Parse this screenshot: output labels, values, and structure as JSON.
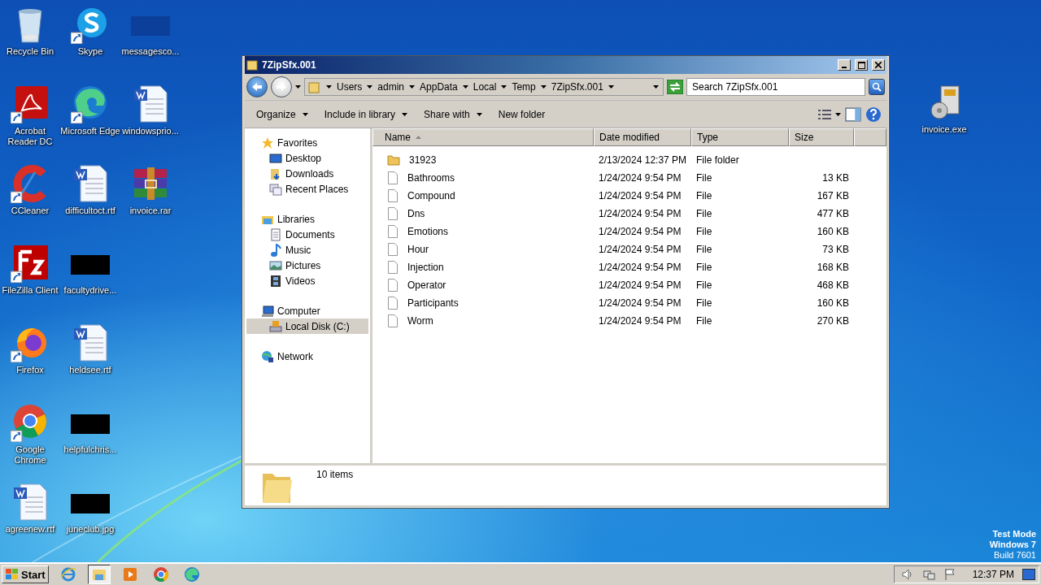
{
  "desktop": {
    "icons": [
      {
        "label": "Recycle Bin",
        "kind": "recycle",
        "shortcut": false
      },
      {
        "label": "Acrobat Reader DC",
        "kind": "acrobat",
        "shortcut": true
      },
      {
        "label": "CCleaner",
        "kind": "ccleaner",
        "shortcut": true
      },
      {
        "label": "FileZilla Client",
        "kind": "filezilla",
        "shortcut": true
      },
      {
        "label": "Firefox",
        "kind": "firefox",
        "shortcut": true
      },
      {
        "label": "Google Chrome",
        "kind": "chrome",
        "shortcut": true
      },
      {
        "label": "agreenew.rtf",
        "kind": "word",
        "shortcut": false
      },
      {
        "label": "Skype",
        "kind": "skype",
        "shortcut": true
      },
      {
        "label": "Microsoft Edge",
        "kind": "edge",
        "shortcut": true
      },
      {
        "label": "difficultoct.rtf",
        "kind": "word",
        "shortcut": false
      },
      {
        "label": "facultydrive...",
        "kind": "redacted",
        "shortcut": false
      },
      {
        "label": "heldsee.rtf",
        "kind": "word",
        "shortcut": false
      },
      {
        "label": "helpfulchris...",
        "kind": "redacted",
        "shortcut": false
      },
      {
        "label": "juneclub.jpg",
        "kind": "redacted",
        "shortcut": false
      },
      {
        "label": "messagesco...",
        "kind": "hidden",
        "shortcut": false
      },
      {
        "label": "windowsprio...",
        "kind": "word",
        "shortcut": false
      },
      {
        "label": "invoice.rar",
        "kind": "rar",
        "shortcut": false
      }
    ],
    "right_icons": [
      {
        "label": "invoice.exe",
        "kind": "exe",
        "shortcut": false
      }
    ],
    "test_mode": [
      "Test Mode",
      "Windows 7",
      "Build 7601"
    ]
  },
  "window": {
    "title": "7ZipSfx.001",
    "address": [
      "Users",
      "admin",
      "AppData",
      "Local",
      "Temp",
      "7ZipSfx.001"
    ],
    "search": {
      "placeholder": "Search 7ZipSfx.001"
    },
    "toolbar": [
      {
        "label": "Organize",
        "dropdown": true
      },
      {
        "label": "Include in library",
        "dropdown": true
      },
      {
        "label": "Share with",
        "dropdown": true
      },
      {
        "label": "New folder",
        "dropdown": false
      }
    ],
    "nav": [
      {
        "label": "Favorites",
        "kind": "star",
        "selected": false,
        "children": [
          {
            "label": "Desktop",
            "kind": "desktop",
            "selected": false
          },
          {
            "label": "Downloads",
            "kind": "downloads",
            "selected": false
          },
          {
            "label": "Recent Places",
            "kind": "recent",
            "selected": false
          }
        ]
      },
      {
        "label": "Libraries",
        "kind": "libraries",
        "selected": false,
        "children": [
          {
            "label": "Documents",
            "kind": "documents",
            "selected": false
          },
          {
            "label": "Music",
            "kind": "music",
            "selected": false
          },
          {
            "label": "Pictures",
            "kind": "pictures",
            "selected": false
          },
          {
            "label": "Videos",
            "kind": "videos",
            "selected": false
          }
        ]
      },
      {
        "label": "Computer",
        "kind": "computer",
        "selected": false,
        "children": [
          {
            "label": "Local Disk (C:)",
            "kind": "disk",
            "selected": true
          }
        ]
      },
      {
        "label": "Network",
        "kind": "network",
        "selected": false
      }
    ],
    "columns": [
      {
        "label": "Name",
        "sorted": true
      },
      {
        "label": "Date modified",
        "sorted": false
      },
      {
        "label": "Type",
        "sorted": false
      },
      {
        "label": "Size",
        "sorted": false
      }
    ],
    "files": [
      {
        "name": "31923",
        "date": "2/13/2024 12:37 PM",
        "type": "File folder",
        "kind": "folder"
      },
      {
        "name": "Bathrooms",
        "date": "1/24/2024 9:54 PM",
        "type": "File",
        "size": "13 KB",
        "kind": "file"
      },
      {
        "name": "Compound",
        "date": "1/24/2024 9:54 PM",
        "type": "File",
        "size": "167 KB",
        "kind": "file"
      },
      {
        "name": "Dns",
        "date": "1/24/2024 9:54 PM",
        "type": "File",
        "size": "477 KB",
        "kind": "file"
      },
      {
        "name": "Emotions",
        "date": "1/24/2024 9:54 PM",
        "type": "File",
        "size": "160 KB",
        "kind": "file"
      },
      {
        "name": "Hour",
        "date": "1/24/2024 9:54 PM",
        "type": "File",
        "size": "73 KB",
        "kind": "file"
      },
      {
        "name": "Injection",
        "date": "1/24/2024 9:54 PM",
        "type": "File",
        "size": "168 KB",
        "kind": "file"
      },
      {
        "name": "Operator",
        "date": "1/24/2024 9:54 PM",
        "type": "File",
        "size": "468 KB",
        "kind": "file"
      },
      {
        "name": "Participants",
        "date": "1/24/2024 9:54 PM",
        "type": "File",
        "size": "160 KB",
        "kind": "file"
      },
      {
        "name": "Worm",
        "date": "1/24/2024 9:54 PM",
        "type": "File",
        "size": "270 KB",
        "kind": "file"
      }
    ],
    "status": "10 items"
  },
  "taskbar": {
    "start": "Start",
    "apps": [
      {
        "kind": "ie",
        "selected": false
      },
      {
        "kind": "explorer",
        "selected": true
      },
      {
        "kind": "media",
        "selected": false
      },
      {
        "kind": "chrome",
        "selected": false
      },
      {
        "kind": "edge",
        "selected": false
      }
    ],
    "time": "12:37 PM"
  }
}
